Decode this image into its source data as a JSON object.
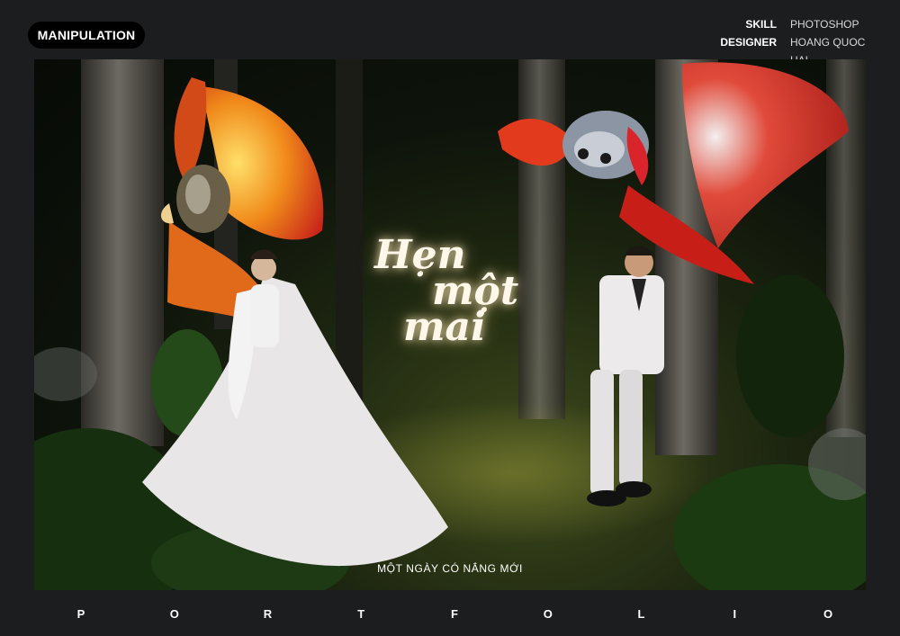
{
  "badge": {
    "label": "MANIPULATION"
  },
  "meta": [
    {
      "key": "SKILL",
      "value": "PHOTOSHOP"
    },
    {
      "key": "DESIGNER",
      "value": "HOANG QUOC HAI"
    }
  ],
  "artwork": {
    "title_lines": [
      "Hẹn",
      "một",
      "mai"
    ],
    "subtitle": "MỘT NGÀY CÓ NẮNG MỚI"
  },
  "footer": {
    "letters": [
      "P",
      "O",
      "R",
      "T",
      "F",
      "O",
      "L",
      "I",
      "O"
    ]
  },
  "colors": {
    "background": "#1c1d1f",
    "fish_orange": "#f08a1a",
    "fish_red": "#d42820",
    "forest": "#1d2610"
  }
}
